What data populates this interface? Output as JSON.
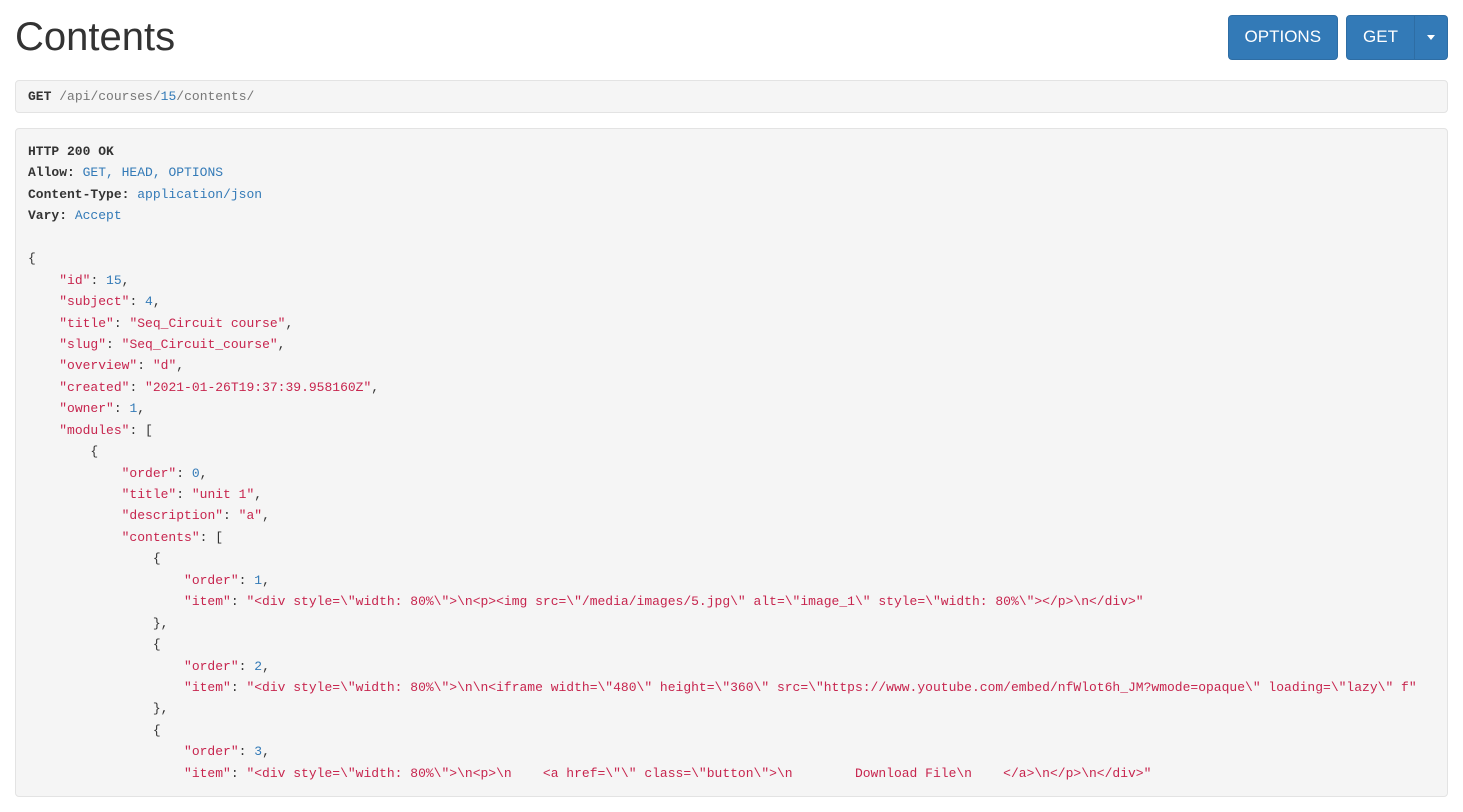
{
  "page": {
    "title": "Contents"
  },
  "toolbar": {
    "options_label": "OPTIONS",
    "get_label": "GET"
  },
  "request": {
    "method": "GET",
    "path_segments": [
      "api",
      "courses",
      "15",
      "contents"
    ]
  },
  "response": {
    "status_line": "HTTP 200 OK",
    "headers": {
      "allow": {
        "label": "Allow:",
        "value": "GET, HEAD, OPTIONS"
      },
      "content_type": {
        "label": "Content-Type:",
        "value": "application/json"
      },
      "vary": {
        "label": "Vary:",
        "value": "Accept"
      }
    },
    "body": {
      "id": 15,
      "subject": 4,
      "title": "Seq_Circuit course",
      "slug": "Seq_Circuit_course",
      "overview": "d",
      "created": "2021-01-26T19:37:39.958160Z",
      "owner": 1,
      "modules": [
        {
          "order": 0,
          "title": "unit 1",
          "description": "a",
          "contents": [
            {
              "order": 1,
              "item": "<div style=\\\"width: 80%\\\">\\n<p><img src=\\\"/media/images/5.jpg\\\" alt=\\\"image_1\\\" style=\\\"width: 80%\\\"></p>\\n</div>"
            },
            {
              "order": 2,
              "item": "<div style=\\\"width: 80%\\\">\\n\\n<iframe width=\\\"480\\\" height=\\\"360\\\" src=\\\"https://www.youtube.com/embed/nfWlot6h_JM?wmode=opaque\\\" loading=\\\"lazy\\\" f"
            },
            {
              "order": 3,
              "item": "<div style=\\\"width: 80%\\\">\\n<p>\\n    <a href=\\\"\\\" class=\\\"button\\\">\\n        Download File\\n    </a>\\n</p>\\n</div>"
            }
          ]
        }
      ]
    }
  }
}
